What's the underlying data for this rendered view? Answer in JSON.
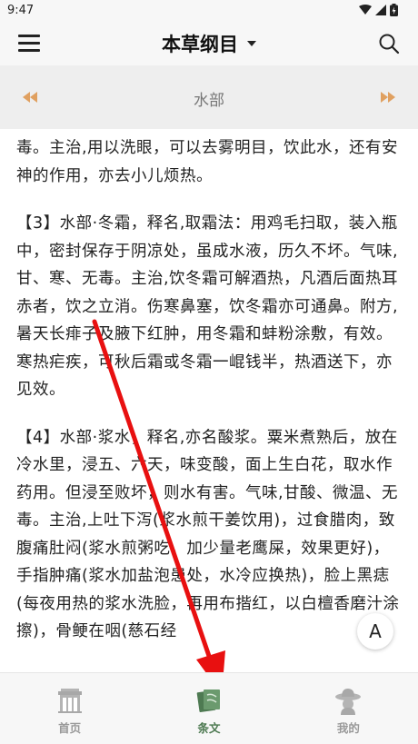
{
  "status": {
    "time": "9:47"
  },
  "header": {
    "title": "本草纲目"
  },
  "chapter": {
    "title": "水部"
  },
  "content": {
    "paragraphs": [
      "毒。主治,用以洗眼，可以去雾明目，饮此水，还有安神的作用，亦去小儿烦热。",
      "【3】水部·冬霜，释名,取霜法：用鸡毛扫取，装入瓶中，密封保存于阴凉处，虽成水液，历久不坏。气味,甘、寒、无毒。主治,饮冬霜可解酒热，凡酒后面热耳赤者，饮之立消。伤寒鼻塞，饮冬霜亦可通鼻。附方,暑天长痱子及腋下红肿，用冬霜和蚌粉涂敷，有效。寒热疟疾，可秋后霜或冬霜一崐钱半，热酒送下，亦见效。",
      "【4】水部·浆水，释名,亦名酸浆。粟米煮熟后，放在冷水里，浸五、六天，味变酸，面上生白花，取水作药用。但浸至败坏，则水有害。气味,甘酸、微温、无毒。主治,上吐下泻(浆水煎干姜饮用)，过食腊肉，致腹痛肚闷(浆水煎粥吃，加少量老鹰屎，效果更好)，手指肿痛(浆水加盐泡患处，水冷应换热)，脸上黑痣(每夜用热的浆水洗脸，再用布揩红，以白檀香磨汁涂擦)，骨鲠在咽(慈石经"
    ]
  },
  "font_button": {
    "label": "A"
  },
  "tabs": [
    {
      "label": "首页",
      "icon": "home-building-icon",
      "active": false
    },
    {
      "label": "条文",
      "icon": "book-icon",
      "active": true
    },
    {
      "label": "我的",
      "icon": "profile-hat-icon",
      "active": false
    }
  ],
  "colors": {
    "accent": "#4e7a52",
    "annotation_arrow": "#e81010",
    "nav_arrows": "#e0a060"
  }
}
